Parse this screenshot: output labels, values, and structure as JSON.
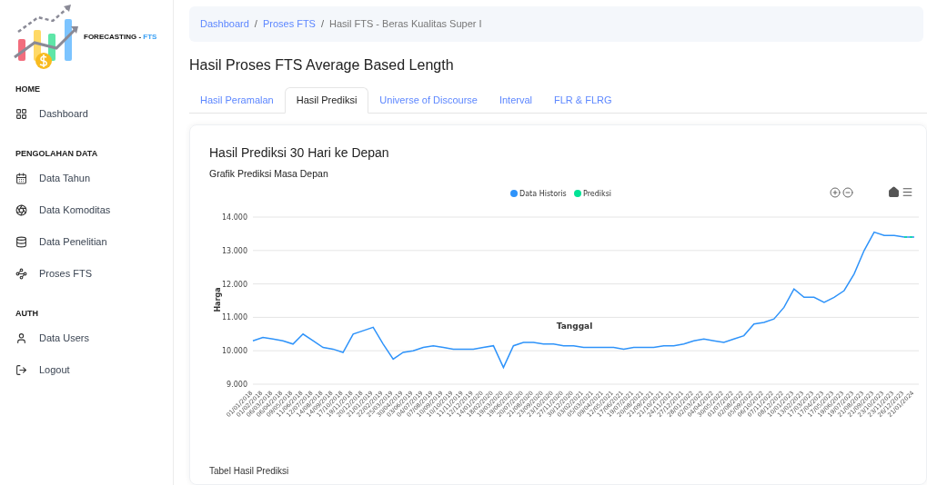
{
  "logo": {
    "text": "FORECASTING - ",
    "accent": "FTS"
  },
  "sidebar": {
    "sections": [
      {
        "title": "HOME",
        "items": [
          {
            "label": "Dashboard",
            "selected": false
          }
        ]
      },
      {
        "title": "PENGOLAHAN DATA",
        "items": [
          {
            "label": "Data Tahun",
            "selected": false
          },
          {
            "label": "Data Komoditas",
            "selected": false
          },
          {
            "label": "Data Penelitian",
            "selected": false
          },
          {
            "label": "Proses FTS",
            "selected": false
          }
        ]
      },
      {
        "title": "AUTH",
        "items": [
          {
            "label": "Data Users",
            "selected": false
          },
          {
            "label": "Logout",
            "selected": false
          }
        ]
      }
    ]
  },
  "breadcrumb": {
    "separator": "/",
    "items": [
      "Dashboard",
      "Proses FTS",
      "Hasil FTS - Beras Kualitas Super I"
    ]
  },
  "page_title": "Hasil Proses FTS Average Based Length",
  "tabs": [
    {
      "label": "Hasil Peramalan",
      "selected": false
    },
    {
      "label": "Hasil Prediksi",
      "selected": true
    },
    {
      "label": "Universe of Discourse",
      "selected": false
    },
    {
      "label": "Interval",
      "selected": false
    },
    {
      "label": "FLR & FLRG",
      "selected": false
    }
  ],
  "card": {
    "title": "Hasil Prediksi 30 Hari ke Depan",
    "subtitle": "Grafik Prediksi Masa Depan",
    "chart_data": {
      "type": "line",
      "xlabel": "Tanggal",
      "ylabel": "Harga",
      "grid": true,
      "legend": true,
      "categories": [
        "01/01/2018",
        "01/02/2018",
        "06/03/2018",
        "06/04/2018",
        "09/05/2018",
        "11/06/2018",
        "12/07/2018",
        "14/08/2018",
        "14/09/2018",
        "17/10/2018",
        "19/11/2018",
        "20/12/2018",
        "21/01/2019",
        "22/02/2019",
        "25/03/2019",
        "30/04/2019",
        "03/06/2019",
        "04/07/2019",
        "07/08/2019",
        "10/09/2019",
        "10/10/2019",
        "11/11/2019",
        "12/12/2019",
        "14/01/2020",
        "18/02/2020",
        "19/03/2020",
        "19/06/2020",
        "20/07/2020",
        "21/08/2020",
        "23/09/2020",
        "23/10/2020",
        "27/11/2020",
        "30/12/2020",
        "03/02/2021",
        "05/03/2021",
        "09/04/2021",
        "12/05/2021",
        "17/06/2021",
        "19/07/2021",
        "20/08/2021",
        "21/09/2021",
        "21/10/2021",
        "24/11/2021",
        "27/12/2021",
        "28/01/2022",
        "02/03/2022",
        "04/04/2022",
        "30/05/2022",
        "01/07/2022",
        "02/08/2022",
        "05/09/2022",
        "06/10/2022",
        "07/11/2022",
        "08/12/2022",
        "10/01/2023",
        "13/02/2023",
        "17/03/2023",
        "17/04/2023",
        "17/05/2023",
        "19/06/2023",
        "19/07/2023",
        "21/08/2023",
        "21/09/2023",
        "23/10/2023",
        "23/11/2023",
        "26/12/2023",
        "21/01/2024"
      ],
      "series": [
        {
          "name": "Data Historis",
          "color": "#2e93fa",
          "line_style": "solid",
          "values": [
            10300,
            10400,
            10350,
            10300,
            10200,
            10500,
            10300,
            10100,
            10050,
            9950,
            10500,
            10600,
            10700,
            10200,
            9750,
            9950,
            10000,
            10100,
            10150,
            10100,
            10050,
            10050,
            10050,
            10100,
            10150,
            9500,
            10150,
            10250,
            10250,
            10200,
            10200,
            10150,
            10150,
            10100,
            10100,
            10100,
            10100,
            10050,
            10100,
            10100,
            10100,
            10150,
            10150,
            10200,
            10300,
            10350,
            10300,
            10250,
            10350,
            10450,
            10800,
            10850,
            10950,
            11300,
            11850,
            11600,
            11600,
            11450,
            11600,
            11800,
            12300,
            13000,
            13550,
            13450,
            13450,
            13400,
            13400
          ]
        },
        {
          "name": "Prediksi",
          "color": "#00e396",
          "line_style": "dashed",
          "values": [
            null,
            null,
            null,
            null,
            null,
            null,
            null,
            null,
            null,
            null,
            null,
            null,
            null,
            null,
            null,
            null,
            null,
            null,
            null,
            null,
            null,
            null,
            null,
            null,
            null,
            null,
            null,
            null,
            null,
            null,
            null,
            null,
            null,
            null,
            null,
            null,
            null,
            null,
            null,
            null,
            null,
            null,
            null,
            null,
            null,
            null,
            null,
            null,
            null,
            null,
            null,
            null,
            null,
            null,
            null,
            null,
            null,
            null,
            null,
            null,
            null,
            null,
            null,
            null,
            null,
            13400,
            13400
          ]
        }
      ],
      "ylim": [
        9000,
        14000
      ],
      "yticks": [
        {
          "value": 9000,
          "label": "9.000"
        },
        {
          "value": 10000,
          "label": "10.000"
        },
        {
          "value": 11000,
          "label": "11.000"
        },
        {
          "value": 12000,
          "label": "12.000"
        },
        {
          "value": 13000,
          "label": "13.000"
        },
        {
          "value": 14000,
          "label": "14.000"
        }
      ]
    },
    "table_title": "Tabel Hasil Prediksi"
  }
}
